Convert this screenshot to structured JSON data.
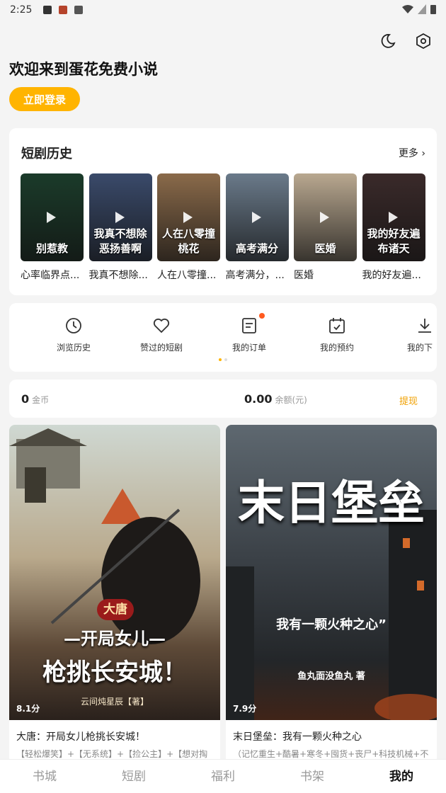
{
  "status": {
    "time": "2:25"
  },
  "header": {
    "welcome": "欢迎来到蛋花免费小说",
    "login_label": "立即登录"
  },
  "history": {
    "title": "短剧历史",
    "more": "更多 ›",
    "items": [
      {
        "name": "心率临界点...",
        "poster_text": "别惹教",
        "color": "#1b3b2a"
      },
      {
        "name": "我真不想除...",
        "poster_text": "我真不想除恶扬善啊",
        "color": "#3a4a6a"
      },
      {
        "name": "人在八零撞...",
        "poster_text": "人在八零撞桃花",
        "color": "#8a6a4a"
      },
      {
        "name": "高考满分，...",
        "poster_text": "高考满分",
        "color": "#6a7a8a"
      },
      {
        "name": "医婚",
        "poster_text": "医婚",
        "color": "#b9a890"
      },
      {
        "name": "我的好友遍...",
        "poster_text": "我的好友遍布诸天",
        "color": "#3a2a2a"
      }
    ]
  },
  "features": [
    {
      "label": "浏览历史",
      "icon": "clock-icon"
    },
    {
      "label": "赞过的短剧",
      "icon": "heart-icon"
    },
    {
      "label": "我的订单",
      "icon": "order-icon"
    },
    {
      "label": "我的预约",
      "icon": "calendar-icon"
    },
    {
      "label": "我的下",
      "icon": "download-icon"
    }
  ],
  "wallet": {
    "coins": "0",
    "coins_unit": "金币",
    "balance": "0.00",
    "balance_unit": "余额(元)",
    "withdraw": "提现"
  },
  "books": [
    {
      "title": "大唐：开局女儿枪挑长安城！",
      "tags": "【轻松爆笑】+【无系统】+【捡公主】+【想对掏",
      "rating": "8.1分",
      "cover_title": "枪挑长安城！",
      "cover_subtitle": "—开局女儿—",
      "cover_badge": "大唐",
      "cover_author": "云间炖星辰【著】"
    },
    {
      "title": "末日堡垒：我有一颗火种之心",
      "tags": "（记忆重生+酷暑+寒冬+囤货+丧尸+科技机械+不",
      "rating": "7.9分",
      "cover_title": "末日堡垒",
      "cover_subtitle": "我有一颗火种之心”",
      "cover_author": "鱼丸面没鱼丸 著"
    }
  ],
  "tabs": [
    {
      "label": "书城",
      "active": false
    },
    {
      "label": "短剧",
      "active": false
    },
    {
      "label": "福利",
      "active": false
    },
    {
      "label": "书架",
      "active": false
    },
    {
      "label": "我的",
      "active": true
    }
  ]
}
